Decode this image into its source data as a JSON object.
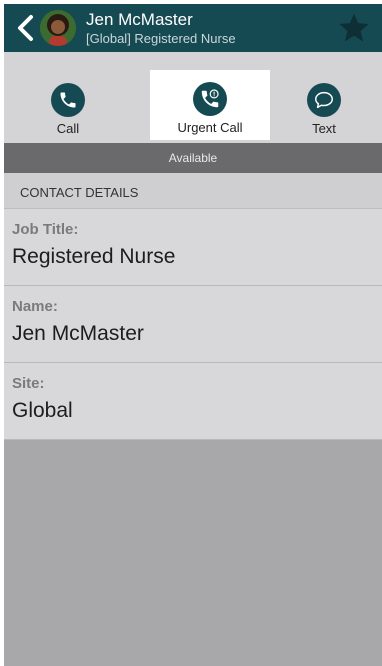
{
  "header": {
    "name": "Jen McMaster",
    "subtitle": "[Global] Registered Nurse",
    "back_icon": "chevron-left-icon",
    "favorite_icon": "star-icon"
  },
  "actions": [
    {
      "label": "Call",
      "icon": "phone-icon"
    },
    {
      "label": "Urgent Call",
      "icon": "urgent-phone-icon"
    },
    {
      "label": "Text",
      "icon": "chat-bubble-icon"
    }
  ],
  "status": "Available",
  "section": {
    "title": "CONTACT DETAILS"
  },
  "details": [
    {
      "label": "Job Title:",
      "value": "Registered Nurse"
    },
    {
      "label": "Name:",
      "value": "Jen McMaster"
    },
    {
      "label": "Site:",
      "value": "Global"
    }
  ],
  "colors": {
    "brand": "#164a53",
    "status_bar": "#6a6a6c",
    "background": "#a8a8ab"
  }
}
